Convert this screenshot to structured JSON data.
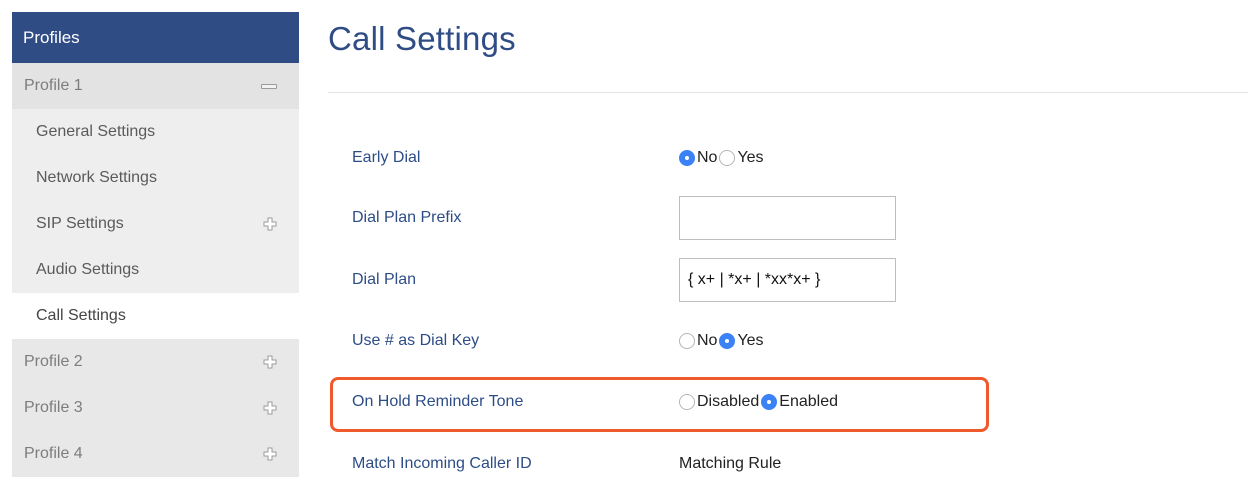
{
  "sidebar": {
    "header": "Profiles",
    "profile1": {
      "label": "Profile 1"
    },
    "subitems": [
      {
        "label": "General Settings"
      },
      {
        "label": "Network Settings"
      },
      {
        "label": "SIP Settings"
      },
      {
        "label": "Audio Settings"
      },
      {
        "label": "Call Settings"
      }
    ],
    "profiles": [
      {
        "label": "Profile 2"
      },
      {
        "label": "Profile 3"
      },
      {
        "label": "Profile 4"
      }
    ]
  },
  "main": {
    "title": "Call Settings",
    "early_dial": {
      "label": "Early Dial",
      "opt_no": "No",
      "opt_yes": "Yes",
      "selected": "No"
    },
    "dial_plan_prefix": {
      "label": "Dial Plan Prefix",
      "value": ""
    },
    "dial_plan": {
      "label": "Dial Plan",
      "value": "{ x+ | *x+ | *xx*x+ }"
    },
    "use_hash": {
      "label": "Use # as Dial Key",
      "opt_no": "No",
      "opt_yes": "Yes",
      "selected": "Yes"
    },
    "on_hold": {
      "label": "On Hold Reminder Tone",
      "opt_disabled": "Disabled",
      "opt_enabled": "Enabled",
      "selected": "Enabled"
    },
    "match_caller": {
      "label": "Match Incoming Caller ID",
      "value": "Matching Rule"
    }
  },
  "colors": {
    "accent": "#2f4c85",
    "radio_selected": "#3b82f6",
    "highlight": "#ee5a2b"
  }
}
